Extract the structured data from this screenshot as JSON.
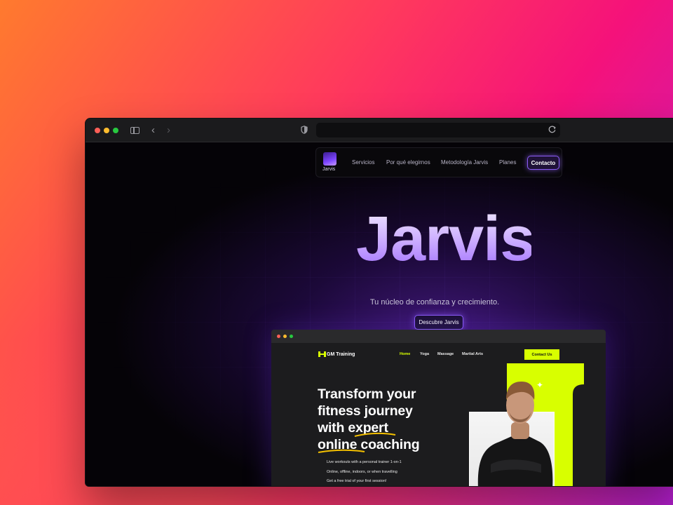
{
  "browser": {
    "address": "",
    "icons": [
      "sidebar-icon",
      "chevron-left-icon",
      "chevron-right-icon",
      "shield-icon",
      "reload-icon"
    ]
  },
  "site": {
    "logo_text": "Jarvis",
    "nav": [
      "Servicios",
      "Por qué elegirnos",
      "Metodología Jarvis",
      "Planes"
    ],
    "contact_label": "Contacto",
    "hero_title": "Jarvis",
    "hero_subtitle": "Tu núcleo de confianza y crecimiento.",
    "cta_label": "Descubre Jarvis",
    "accent_color": "#8b5cf6"
  },
  "preview": {
    "brand": "GM Training",
    "nav": [
      "Home",
      "Yoga",
      "Massage",
      "Martial Arts"
    ],
    "active_nav": "Home",
    "contact_label": "Contact Us",
    "headline_lines": [
      "Transform your",
      "fitness journey",
      "with expert",
      "online coaching"
    ],
    "bullets": [
      "Live workouts with a personal trainer 1-on-1",
      "Online, offline, indoors, or when travelling",
      "Get a free trial of your first session!"
    ],
    "accent_color": "#d8ff00"
  }
}
